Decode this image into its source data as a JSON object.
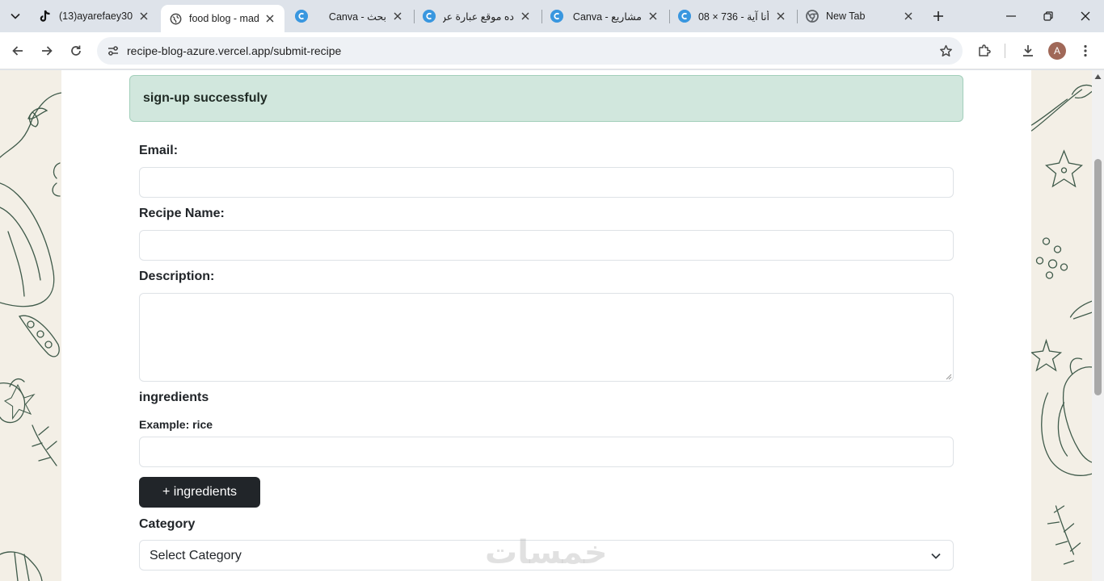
{
  "browser": {
    "tabs": [
      {
        "title": "(13)ayarefaey30",
        "icon": "tiktok-icon",
        "active": false
      },
      {
        "title": "food blog - made",
        "icon": "globe-icon",
        "active": true
      },
      {
        "title": "بحث - Canva",
        "icon": "canva-icon",
        "active": false
      },
      {
        "title": "ده موقع عبارة عن",
        "icon": "canva-icon",
        "active": false
      },
      {
        "title": "مشاريع - Canva",
        "icon": "canva-icon",
        "active": false
      },
      {
        "title": "أنا آية - 736 × 08",
        "icon": "canva-icon",
        "active": false
      },
      {
        "title": "New Tab",
        "icon": "chrome-icon",
        "active": false
      }
    ],
    "url": "recipe-blog-azure.vercel.app/submit-recipe",
    "avatar_letter": "A"
  },
  "alert": {
    "message": "sign-up successfuly"
  },
  "form": {
    "email_label": "Email:",
    "email_value": "",
    "recipe_name_label": "Recipe Name:",
    "recipe_name_value": "",
    "description_label": "Description:",
    "description_value": "",
    "ingredients_heading": "ingredients",
    "ingredients_example": "Example: rice",
    "ingredient_value": "",
    "add_ingredient_button": "+ ingredients",
    "category_label": "Category",
    "category_selected": "Select Category"
  },
  "watermark": "خمسات",
  "colors": {
    "alert_bg": "#d1e7dd",
    "alert_border": "#a3cfbb",
    "button_dark": "#212529",
    "page_bg": "#f3efe6",
    "doodle_stroke": "#3f5a4a"
  }
}
